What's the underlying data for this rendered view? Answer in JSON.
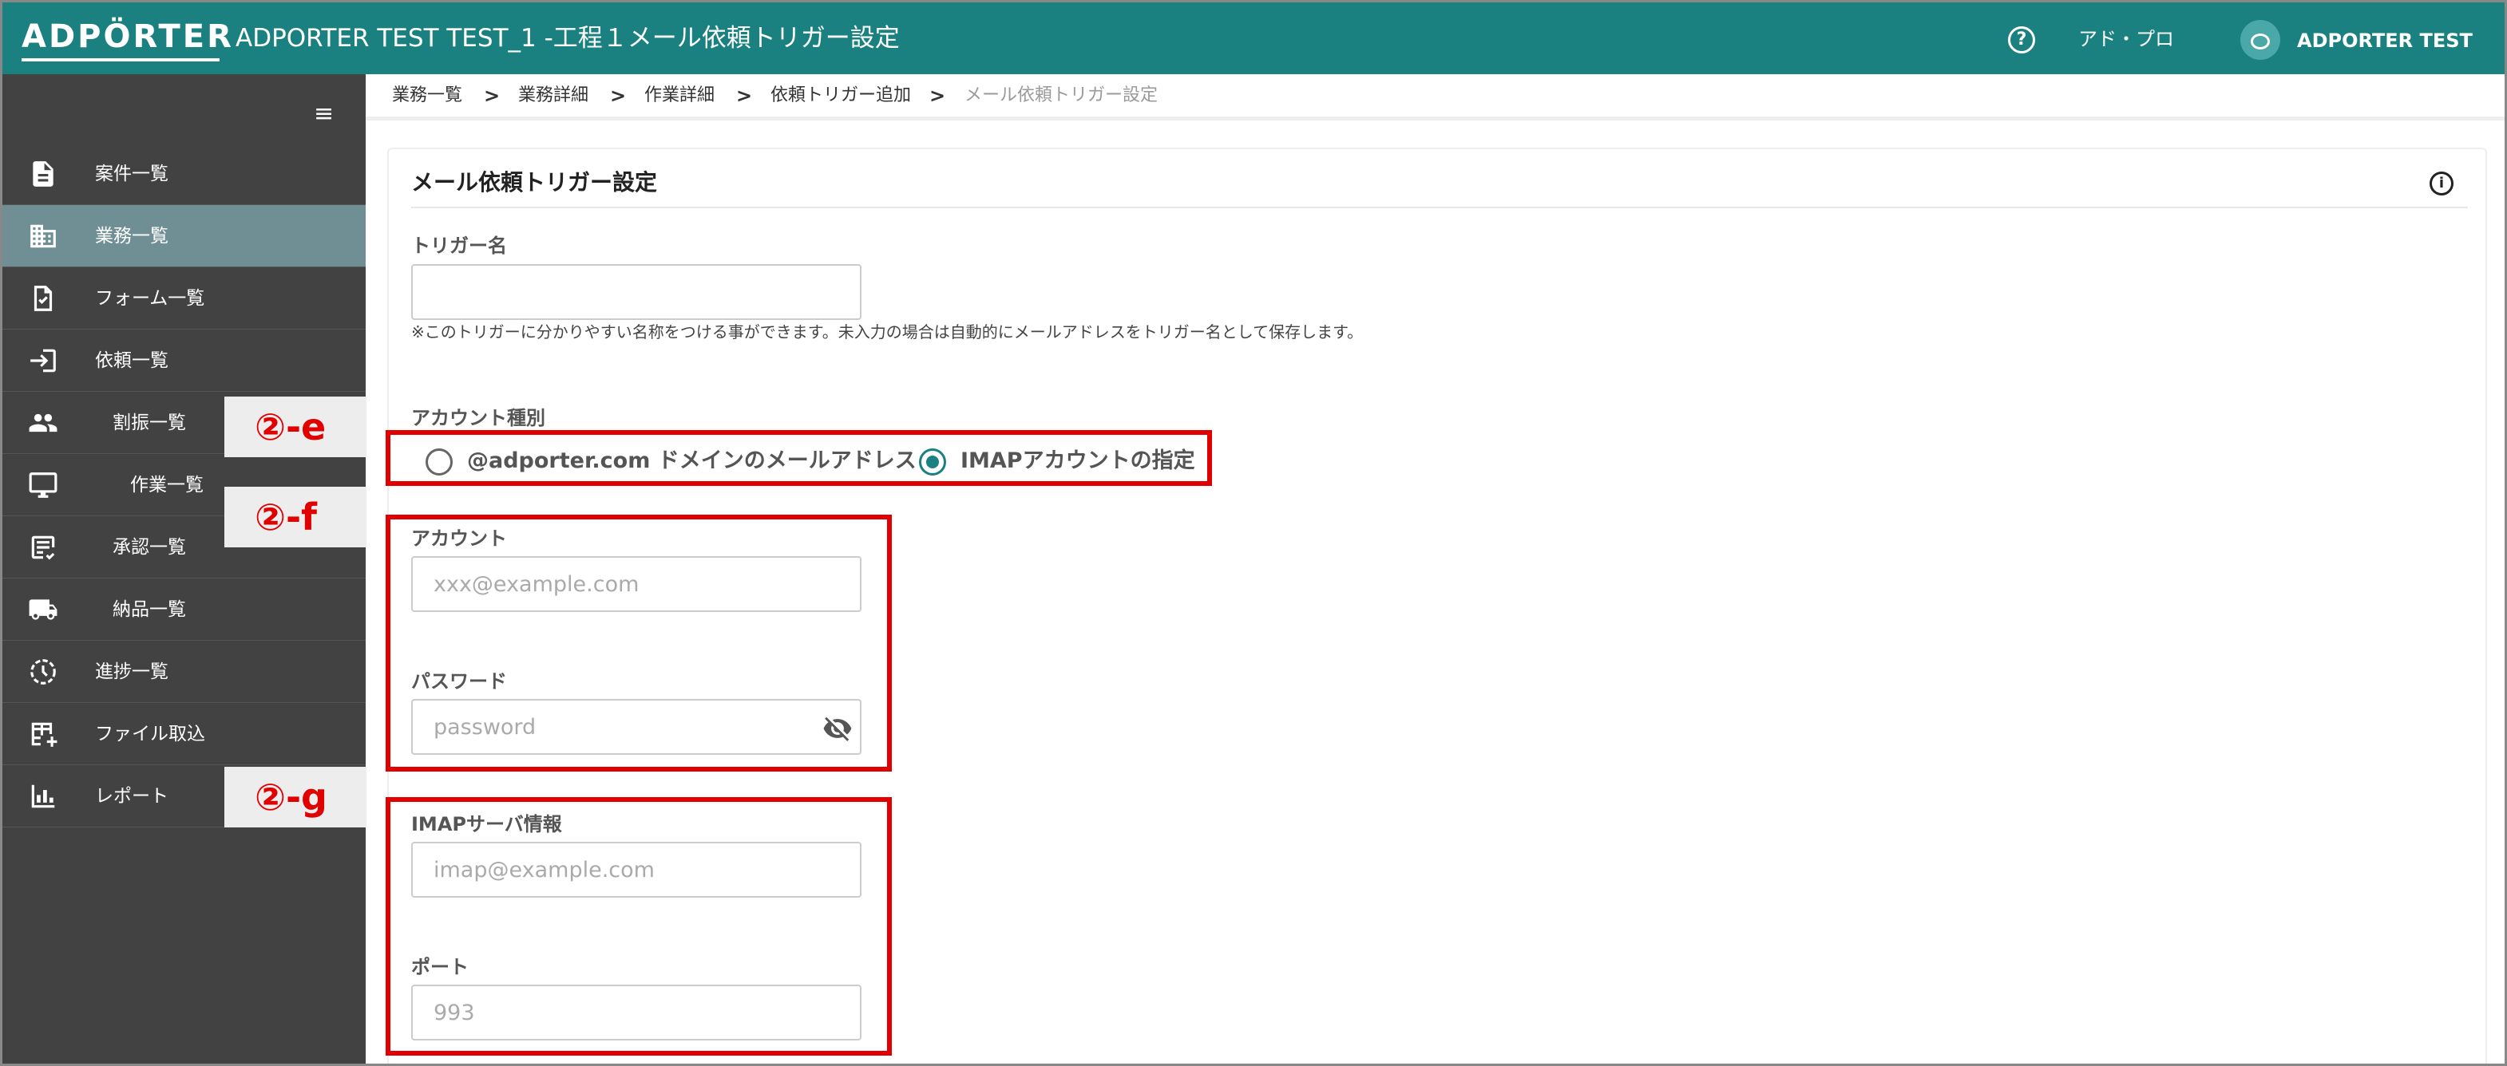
{
  "header": {
    "logo": "ADPÖRTER",
    "title": "ADPORTER TEST TEST_1 -工程１メール依頼トリガー設定",
    "company": "アド・プロ",
    "user": "ADPORTER TEST",
    "help_icon": "help-circle-icon"
  },
  "sidebar": {
    "items": [
      {
        "label": "案件一覧",
        "icon": "document-list-icon"
      },
      {
        "label": "業務一覧",
        "icon": "building-icon"
      },
      {
        "label": "フォーム一覧",
        "icon": "form-file-icon"
      },
      {
        "label": "依頼一覧",
        "icon": "login-arrow-icon"
      },
      {
        "label": "割振一覧",
        "icon": "people-icon"
      },
      {
        "label": "作業一覧",
        "icon": "monitor-icon"
      },
      {
        "label": "承認一覧",
        "icon": "approval-icon"
      },
      {
        "label": "納品一覧",
        "icon": "truck-icon"
      },
      {
        "label": "進捗一覧",
        "icon": "clock-icon"
      },
      {
        "label": "ファイル取込",
        "icon": "table-add-icon"
      },
      {
        "label": "レポート",
        "icon": "bar-chart-icon"
      }
    ]
  },
  "annotations": {
    "e": "②-e",
    "f": "②-f",
    "g": "②-g"
  },
  "breadcrumb": {
    "items": [
      "業務一覧",
      "業務詳細",
      "作業詳細",
      "依頼トリガー追加"
    ],
    "separator": ">",
    "current": "メール依頼トリガー設定"
  },
  "form": {
    "title": "メール依頼トリガー設定",
    "trigger_name": {
      "label": "トリガー名",
      "value": "",
      "hint": "※このトリガーに分かりやすい名称をつける事ができます。未入力の場合は自動的にメールアドレスをトリガー名として保存します。"
    },
    "account_type": {
      "label": "アカウント種別",
      "options": [
        "@adporter.com ドメインのメールアドレス",
        "IMAPアカウントの指定"
      ],
      "selected": "IMAPアカウントの指定"
    },
    "account": {
      "label": "アカウント",
      "placeholder": "xxx@example.com"
    },
    "password": {
      "label": "パスワード",
      "placeholder": "password"
    },
    "imap_server": {
      "label": "IMAPサーバ情報",
      "placeholder": "imap@example.com"
    },
    "port": {
      "label": "ポート",
      "placeholder": "993"
    }
  },
  "colors": {
    "header": "#1b8080",
    "sidebar": "#424242",
    "sidebar_active": "#6f8f95",
    "annotation": "#e00000",
    "radio_selected": "#1b8080"
  }
}
